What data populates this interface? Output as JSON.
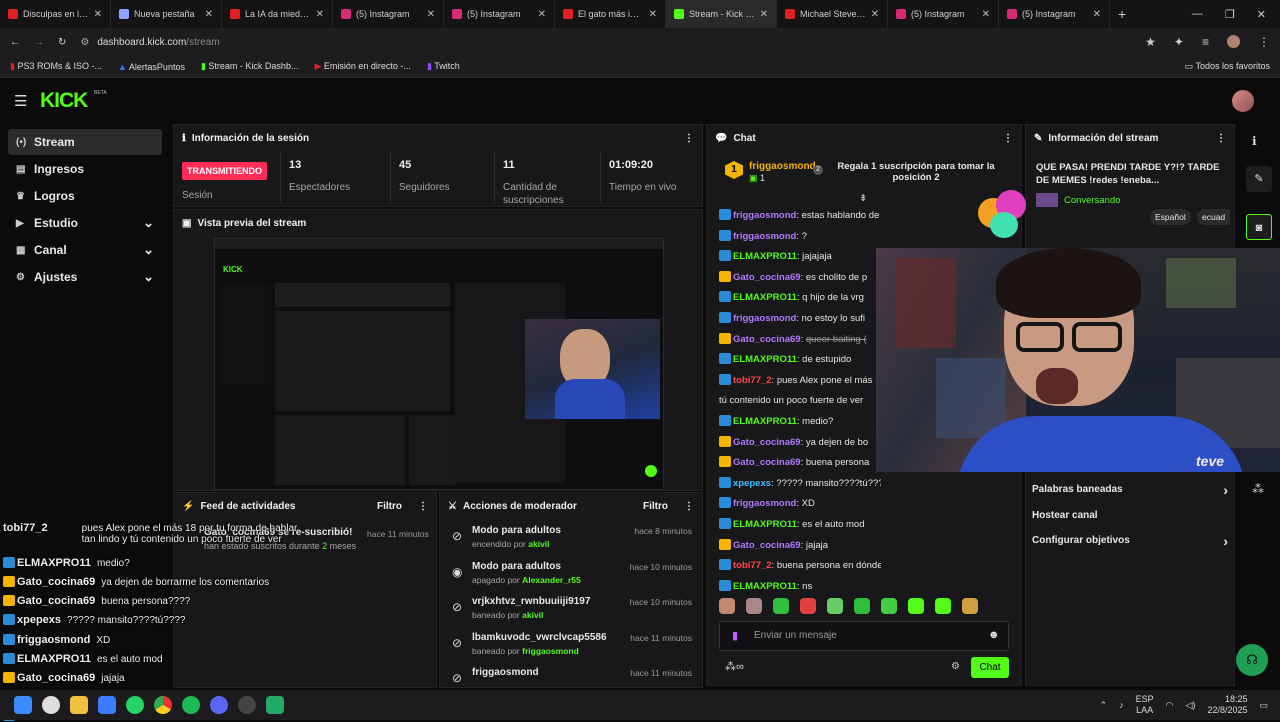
{
  "tabs": [
    {
      "label": "Disculpas en las R",
      "color": "#e02020"
    },
    {
      "label": "Nueva pestaña",
      "color": "#8aa4ff"
    },
    {
      "label": "La IA da miedo #",
      "color": "#e02020"
    },
    {
      "label": "(5) Instagram",
      "color": "#d62976"
    },
    {
      "label": "(5) Instagram",
      "color": "#d62976"
    },
    {
      "label": "El gato más intelig",
      "color": "#e02020"
    },
    {
      "label": "Stream - Kick Dash",
      "color": "#53fc18"
    },
    {
      "label": "Michael Steven: L",
      "color": "#e02020"
    },
    {
      "label": "(5) Instagram",
      "color": "#d62976"
    },
    {
      "label": "(5) Instagram",
      "color": "#d62976"
    }
  ],
  "address": {
    "host": "dashboard.kick.com",
    "path": "/stream"
  },
  "bookmarks": [
    "PS3 ROMs & ISO -...",
    "AlertasPuntos",
    "Stream - Kick Dashb...",
    "Emisión en directo -...",
    "Twitch"
  ],
  "bookmarks_all": "Todos los favoritos",
  "brand": {
    "logo": "KICK",
    "beta": "BETA",
    "accent": "#53fc18"
  },
  "sidebar": [
    {
      "icon": "(•)",
      "label": "Stream",
      "active": true
    },
    {
      "icon": "▤",
      "label": "Ingresos"
    },
    {
      "icon": "♛",
      "label": "Logros"
    },
    {
      "icon": "▶",
      "label": "Estudio",
      "chevron": "⌄"
    },
    {
      "icon": "▦",
      "label": "Canal",
      "chevron": "⌄"
    },
    {
      "icon": "⚙",
      "label": "Ajustes",
      "chevron": "⌄"
    }
  ],
  "session": {
    "title": "Información de la sesión",
    "live_badge": "TRANSMITIENDO",
    "live_label": "Sesión",
    "stats": [
      {
        "value": "13",
        "label": "Espectadores"
      },
      {
        "value": "45",
        "label": "Seguidores"
      },
      {
        "value": "11",
        "label": "Cantidad de suscripciones"
      },
      {
        "value": "01:09:20",
        "label": "Tiempo en vivo"
      }
    ]
  },
  "preview": {
    "title": "Vista previa del stream"
  },
  "feed": {
    "title": "Feed de actividades",
    "filter": "Filtro",
    "resub_user": "Gato_cocina69",
    "resub_text": "se re-suscribió!",
    "resub_sub": "han estado suscritos durante",
    "resub_months": "2",
    "resub_unit": "meses",
    "resub_time": "hace 11 minutos"
  },
  "mod": {
    "title": "Acciones de moderador",
    "filter": "Filtro",
    "rows": [
      {
        "icon": "⊘",
        "title": "Modo para adultos",
        "sub": "encendido por",
        "by": "akivil",
        "time": "hace 8 minutos"
      },
      {
        "icon": "◉",
        "title": "Modo para adultos",
        "sub": "apagado por",
        "by": "Alexander_r55",
        "time": "hace 10 minutos"
      },
      {
        "icon": "⊘",
        "title": "vrjkxhtvz_rwnbuuiiji9197",
        "sub": "baneado por",
        "by": "akivil",
        "time": "hace 10 minutos"
      },
      {
        "icon": "⊘",
        "title": "lbamkuvodc_vwrclvcap5586",
        "sub": "baneado por",
        "by": "friggaosmond",
        "time": "hace 11 minutos"
      },
      {
        "icon": "⊘",
        "title": "friggaosmond",
        "sub": "",
        "by": "",
        "time": "hace 11 minutos"
      }
    ]
  },
  "chat": {
    "title": "Chat",
    "top_user": "friggaosmond",
    "top_rank": "1",
    "top_count": "1",
    "top_count_badge": "2",
    "gift_text": "Regala 1 suscripción para tomar la posición 2",
    "messages": [
      {
        "user": "friggaosmond",
        "color": "#b478ff",
        "text": "estas hablando de altura"
      },
      {
        "user": "friggaosmond",
        "color": "#b478ff",
        "text": "?"
      },
      {
        "user": "ELMAXPRO11",
        "color": "#53fc18",
        "text": "jajajaja"
      },
      {
        "user": "Gato_cocina69",
        "color": "#b478ff",
        "text": "es cholito de p"
      },
      {
        "user": "ELMAXPRO11",
        "color": "#53fc18",
        "text": "q hijo de la vrg"
      },
      {
        "user": "friggaosmond",
        "color": "#b478ff",
        "text": "no estoy lo sufi"
      },
      {
        "user": "Gato_cocina69",
        "color": "#b478ff",
        "text": "queer baiting (",
        "strike": true
      },
      {
        "user": "ELMAXPRO11",
        "color": "#53fc18",
        "text": "de estupido"
      },
      {
        "user": "tobi77_2",
        "color": "#ff4a4a",
        "text": "pues Alex pone el más 18 po"
      },
      {
        "user": "",
        "color": "#e6e6e6",
        "text": "tú contenido un poco fuerte de ver"
      },
      {
        "user": "ELMAXPRO11",
        "color": "#53fc18",
        "text": "medio?"
      },
      {
        "user": "Gato_cocina69",
        "color": "#b478ff",
        "text": "ya dejen de bo"
      },
      {
        "user": "Gato_cocina69",
        "color": "#b478ff",
        "text": "buena persona"
      },
      {
        "user": "xpepexs",
        "color": "#3ec1ff",
        "text": "????? mansito????tú????"
      },
      {
        "user": "friggaosmond",
        "color": "#b478ff",
        "text": "XD"
      },
      {
        "user": "ELMAXPRO11",
        "color": "#53fc18",
        "text": "es el auto mod"
      },
      {
        "user": "Gato_cocina69",
        "color": "#b478ff",
        "text": "jajaja"
      },
      {
        "user": "tobi77_2",
        "color": "#ff4a4a",
        "text": "buena persona en dónde"
      },
      {
        "user": "ELMAXPRO11",
        "color": "#53fc18",
        "text": "ns"
      }
    ],
    "placeholder": "Enviar un mensaje",
    "send": "Chat"
  },
  "streaminfo": {
    "title": "Información del stream",
    "stream_title": "QUE PASA! PRENDI TARDE Y?!? TARDE DE MEMES !redes !eneba...",
    "category": "Conversando",
    "tags": [
      "Español",
      "ecuad"
    ],
    "menu": [
      {
        "label": "Palabras baneadas",
        "arrow": "›"
      },
      {
        "label": "Hostear canal",
        "arrow": ""
      },
      {
        "label": "Configurar objetivos",
        "arrow": "›"
      }
    ]
  },
  "overlay_chat": [
    {
      "user": "tobi77_2",
      "text": "pues Alex pone el más 18 por tu forma de hablar tan lindo y tú contenido un poco fuerte de ver"
    },
    {
      "user": "ELMAXPRO11",
      "text": "medio?"
    },
    {
      "user": "Gato_cocina69",
      "text": "ya dejen de borrarme los comentarios"
    },
    {
      "user": "Gato_cocina69",
      "text": "buena persona????"
    },
    {
      "user": "xpepexs",
      "text": "????? mansito????tú????"
    },
    {
      "user": "friggaosmond",
      "text": "XD"
    },
    {
      "user": "ELMAXPRO11",
      "text": "es el auto mod"
    },
    {
      "user": "Gato_cocina69",
      "text": "jajaja"
    },
    {
      "user": "tobi77_2",
      "text": "buena persona en dónde"
    },
    {
      "user": "ELMAXPRO11",
      "text": "ns"
    }
  ],
  "taskbar": {
    "lang1": "ESP",
    "lang2": "LAA",
    "time": "18:25",
    "date": "22/8/2025"
  }
}
